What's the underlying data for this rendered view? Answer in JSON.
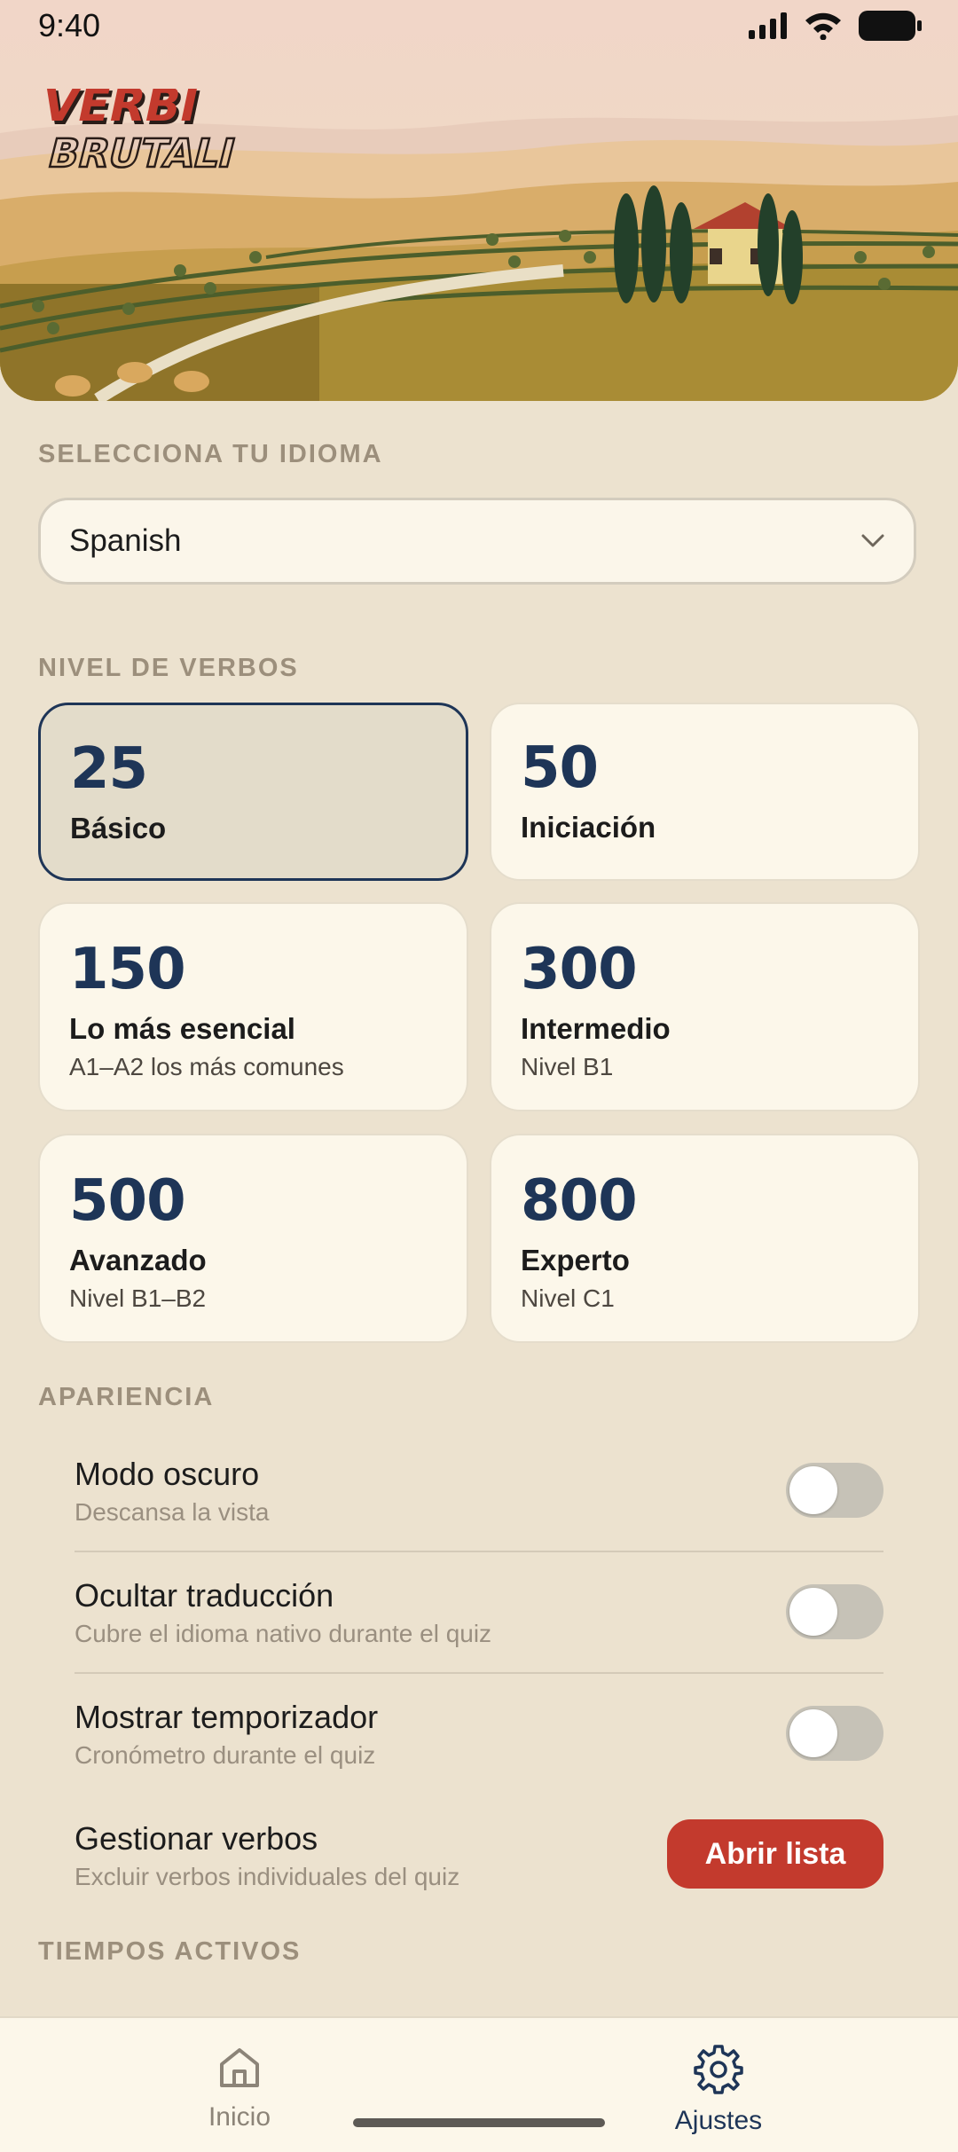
{
  "status_bar": {
    "time": "9:40"
  },
  "brand": {
    "line1": "VERBI",
    "line2": "BRUTALI"
  },
  "language": {
    "section_label": "SELECCIONA TU IDIOMA",
    "selected": "Spanish"
  },
  "levels": {
    "section_label": "NIVEL DE VERBOS",
    "items": [
      {
        "count": "25",
        "title": "Básico",
        "subtitle": "",
        "selected": true
      },
      {
        "count": "50",
        "title": "Iniciación",
        "subtitle": ""
      },
      {
        "count": "150",
        "title": "Lo más esencial",
        "subtitle": "A1–A2 los más comunes"
      },
      {
        "count": "300",
        "title": "Intermedio",
        "subtitle": "Nivel B1"
      },
      {
        "count": "500",
        "title": "Avanzado",
        "subtitle": "Nivel B1–B2"
      },
      {
        "count": "800",
        "title": "Experto",
        "subtitle": "Nivel C1"
      }
    ]
  },
  "appearance": {
    "section_label": "APARIENCIA",
    "settings": [
      {
        "title": "Modo oscuro",
        "subtitle": "Descansa la vista",
        "enabled": false
      },
      {
        "title": "Ocultar traducción",
        "subtitle": "Cubre el idioma nativo durante el quiz",
        "enabled": false
      },
      {
        "title": "Mostrar temporizador",
        "subtitle": "Cronómetro durante el quiz",
        "enabled": false
      }
    ],
    "manage": {
      "title": "Gestionar verbos",
      "subtitle": "Excluir verbos individuales del quiz",
      "button": "Abrir lista"
    }
  },
  "tenses": {
    "section_label": "TIEMPOS ACTIVOS"
  },
  "nav": {
    "items": [
      {
        "label": "Inicio",
        "icon": "home-icon",
        "active": false
      },
      {
        "label": "Ajustes",
        "icon": "gear-icon",
        "active": true
      }
    ]
  },
  "colors": {
    "accent": "#1e3557",
    "danger": "#c33a2d",
    "background": "#ece2cf",
    "card": "#fcf7ea"
  }
}
